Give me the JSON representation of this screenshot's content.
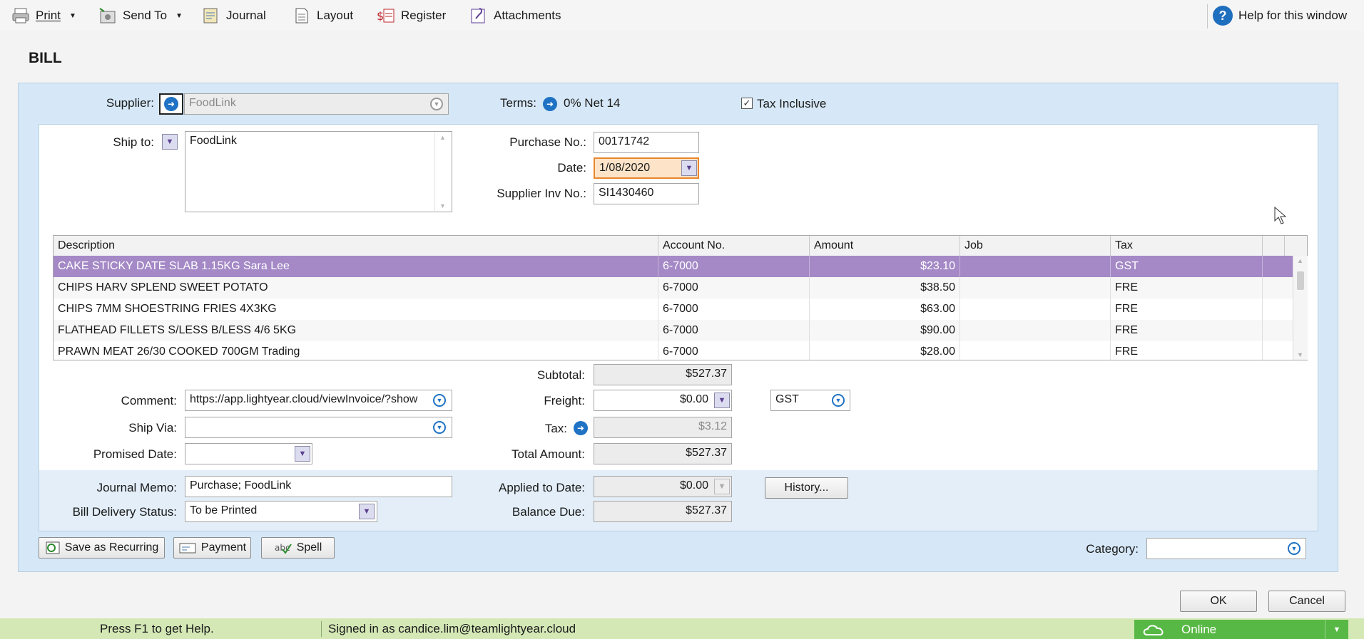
{
  "toolbar": {
    "print": "Print",
    "send_to": "Send To",
    "journal": "Journal",
    "layout": "Layout",
    "register": "Register",
    "attachments": "Attachments",
    "help": "Help for this window"
  },
  "page_title": "BILL",
  "header": {
    "supplier_label": "Supplier:",
    "supplier_value": "FoodLink",
    "terms_label": "Terms:",
    "terms_value": "0% Net 14",
    "tax_inclusive_label": "Tax Inclusive",
    "tax_inclusive_checked": true
  },
  "ship": {
    "label": "Ship to:",
    "value": "FoodLink"
  },
  "purchase": {
    "purchase_no_label": "Purchase No.:",
    "purchase_no": "00171742",
    "date_label": "Date:",
    "date": "1/08/2020",
    "supplier_inv_label": "Supplier Inv No.:",
    "supplier_inv": "SI1430460"
  },
  "grid": {
    "columns": [
      "Description",
      "Account No.",
      "Amount",
      "Job",
      "Tax"
    ],
    "rows": [
      {
        "description": "CAKE STICKY DATE SLAB 1.15KG Sara Lee",
        "account": "6-7000",
        "amount": "$23.10",
        "job": "",
        "tax": "GST"
      },
      {
        "description": "CHIPS HARV SPLEND SWEET POTATO",
        "account": "6-7000",
        "amount": "$38.50",
        "job": "",
        "tax": "FRE"
      },
      {
        "description": "CHIPS 7MM SHOESTRING FRIES 4X3KG",
        "account": "6-7000",
        "amount": "$63.00",
        "job": "",
        "tax": "FRE"
      },
      {
        "description": "FLATHEAD FILLETS S/LESS B/LESS 4/6 5KG",
        "account": "6-7000",
        "amount": "$90.00",
        "job": "",
        "tax": "FRE"
      },
      {
        "description": "PRAWN MEAT 26/30 COOKED 700GM Trading",
        "account": "6-7000",
        "amount": "$28.00",
        "job": "",
        "tax": "FRE"
      }
    ]
  },
  "totals": {
    "subtotal_label": "Subtotal:",
    "subtotal": "$527.37",
    "freight_label": "Freight:",
    "freight": "$0.00",
    "freight_tax": "GST",
    "tax_label": "Tax:",
    "tax": "$3.12",
    "total_label": "Total Amount:",
    "total": "$527.37",
    "applied_label": "Applied to Date:",
    "applied": "$0.00",
    "balance_label": "Balance Due:",
    "balance": "$527.37",
    "history_button": "History..."
  },
  "details": {
    "comment_label": "Comment:",
    "comment": "https://app.lightyear.cloud/viewInvoice/?show",
    "ship_via_label": "Ship Via:",
    "ship_via": "",
    "promised_label": "Promised Date:",
    "promised": "",
    "memo_label": "Journal Memo:",
    "memo": "Purchase; FoodLink",
    "delivery_label": "Bill Delivery Status:",
    "delivery": "To be Printed"
  },
  "footer": {
    "save_recurring": "Save as Recurring",
    "payment": "Payment",
    "spell": "Spell",
    "category_label": "Category:",
    "category": "",
    "ok": "OK",
    "cancel": "Cancel"
  },
  "status": {
    "help_text": "Press F1 to get Help.",
    "signed_in": "Signed in as candice.lim@teamlightyear.cloud",
    "online": "Online"
  }
}
